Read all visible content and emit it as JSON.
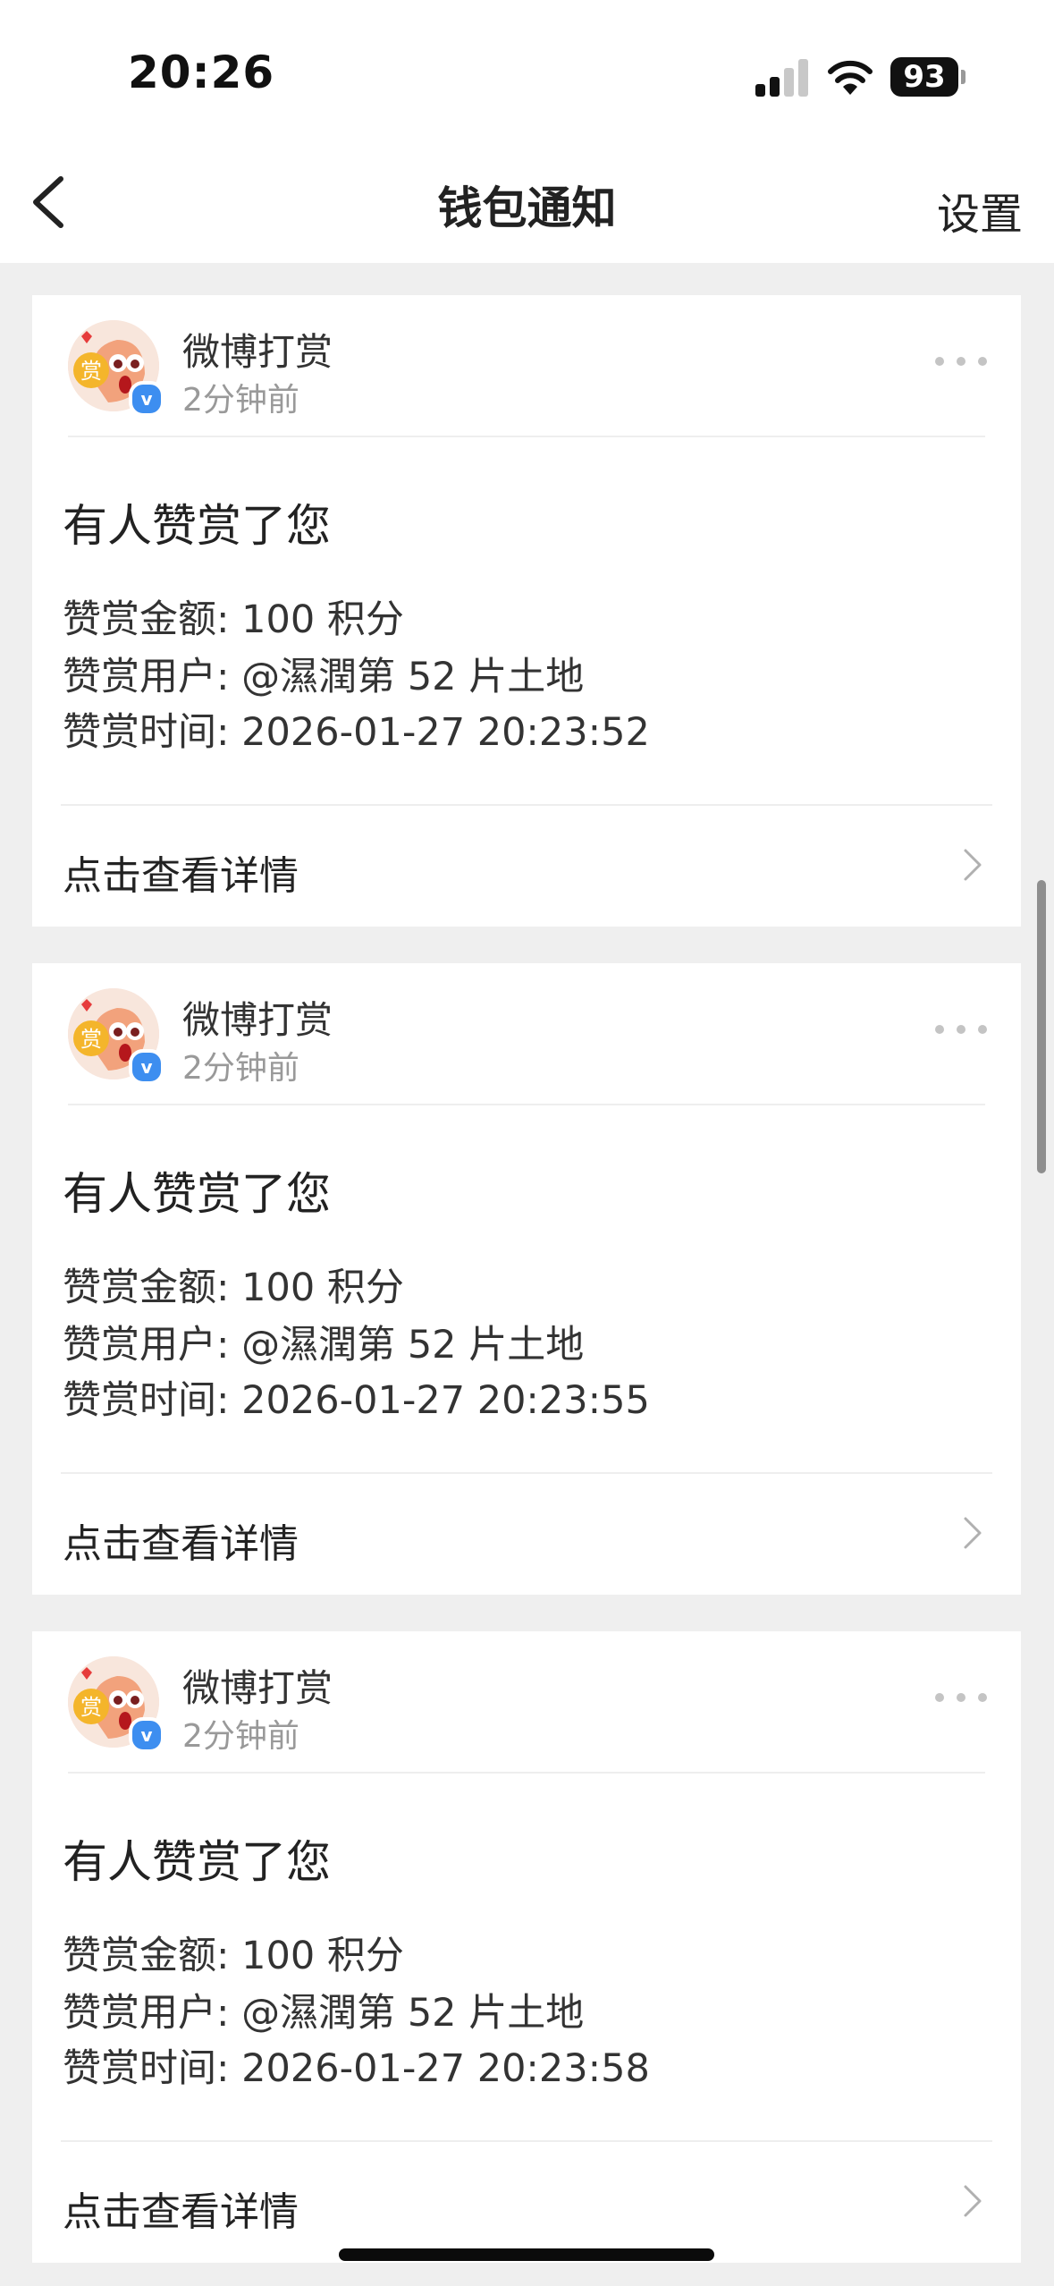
{
  "status_bar": {
    "time": "20:26",
    "battery": "93"
  },
  "nav": {
    "title": "钱包通知",
    "settings_label": "设置"
  },
  "notifications": [
    {
      "sender": "微博打赏",
      "time_ago": "2分钟前",
      "headline": "有人赞赏了您",
      "amount_line": "赞赏金额: 100 积分",
      "user_line": "赞赏用户: @濕潤第 52 片土地",
      "time_line": "赞赏时间: 2026-01-27 20:23:52",
      "link_label": "点击查看详情"
    },
    {
      "sender": "微博打赏",
      "time_ago": "2分钟前",
      "headline": "有人赞赏了您",
      "amount_line": "赞赏金额: 100 积分",
      "user_line": "赞赏用户: @濕潤第 52 片土地",
      "time_line": "赞赏时间: 2026-01-27 20:23:55",
      "link_label": "点击查看详情"
    },
    {
      "sender": "微博打赏",
      "time_ago": "2分钟前",
      "headline": "有人赞赏了您",
      "amount_line": "赞赏金额: 100 积分",
      "user_line": "赞赏用户: @濕潤第 52 片土地",
      "time_line": "赞赏时间: 2026-01-27 20:23:58",
      "link_label": "点击查看详情"
    }
  ],
  "avatar": {
    "badge_char": "赏",
    "verified_char": "v"
  },
  "icons": {
    "back": "chevron-left-icon",
    "more": "more-horizontal-icon",
    "link": "chevron-right-icon"
  },
  "colors": {
    "background": "#efefef",
    "card": "#ffffff",
    "secondary_text": "#999999",
    "verified": "#3d8ef0"
  }
}
